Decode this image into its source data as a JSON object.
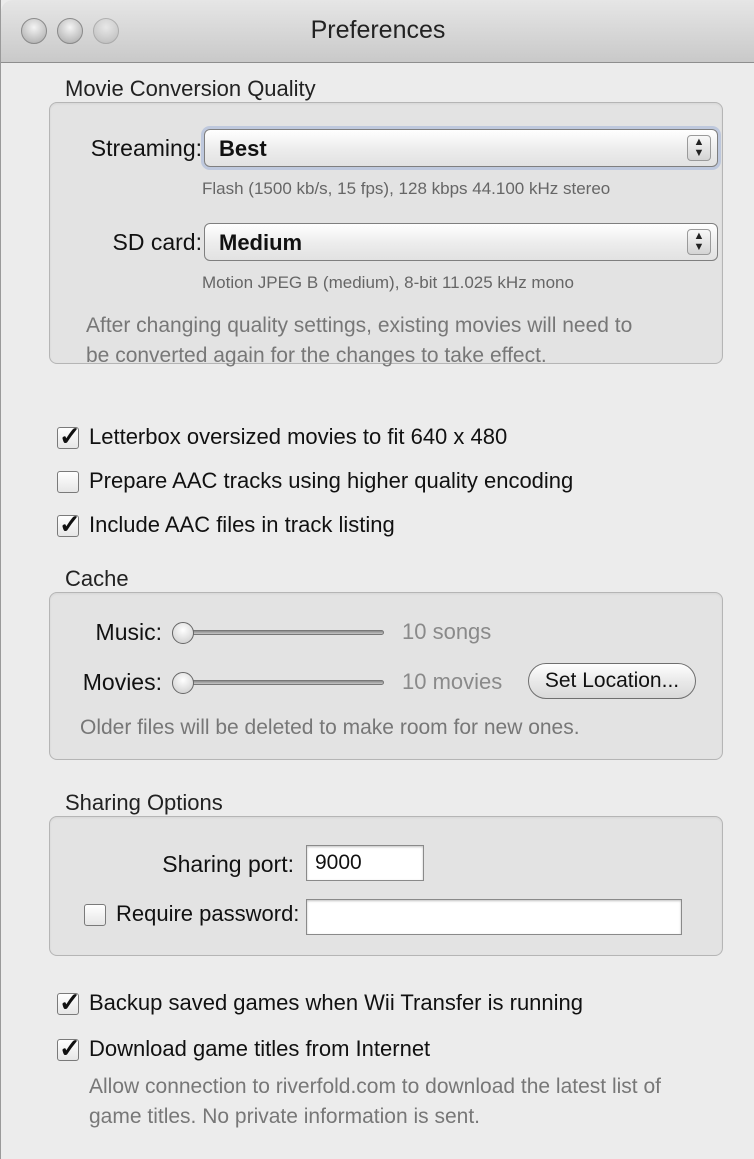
{
  "window": {
    "title": "Preferences"
  },
  "movie_conversion": {
    "label": "Movie Conversion Quality",
    "streaming": {
      "label": "Streaming:",
      "value": "Best",
      "hint": "Flash (1500 kb/s, 15 fps), 128 kbps 44.100 kHz stereo"
    },
    "sdcard": {
      "label": "SD card:",
      "value": "Medium",
      "hint": "Motion JPEG B (medium), 8-bit 11.025 kHz mono"
    },
    "note_line1": "After changing quality settings, existing movies will need to",
    "note_line2": "be converted again for the changes to take effect."
  },
  "checkboxes": {
    "letterbox": {
      "label": "Letterbox oversized movies to fit 640 x 480",
      "checked": true
    },
    "aac_quality": {
      "label": "Prepare AAC tracks using higher quality encoding",
      "checked": false
    },
    "aac_listing": {
      "label": "Include AAC files in track listing",
      "checked": true
    }
  },
  "cache": {
    "label": "Cache",
    "music": {
      "label": "Music:",
      "value": "10 songs",
      "level": 0
    },
    "movies": {
      "label": "Movies:",
      "value": "10 movies",
      "level": 0
    },
    "set_location": "Set Location...",
    "note": "Older files will be deleted to make room for new ones."
  },
  "sharing": {
    "label": "Sharing Options",
    "port_label": "Sharing port:",
    "port_value": "9000",
    "require_password": {
      "label": "Require password:",
      "checked": false
    },
    "password_value": ""
  },
  "bottom": {
    "backup": {
      "label": "Backup saved games when Wii Transfer is running",
      "checked": true
    },
    "download": {
      "label": "Download game titles from Internet",
      "checked": true
    },
    "note_line1": "Allow connection to riverfold.com to download the latest list of",
    "note_line2": "game titles. No private information is sent."
  },
  "icons": {
    "check": "✓"
  }
}
